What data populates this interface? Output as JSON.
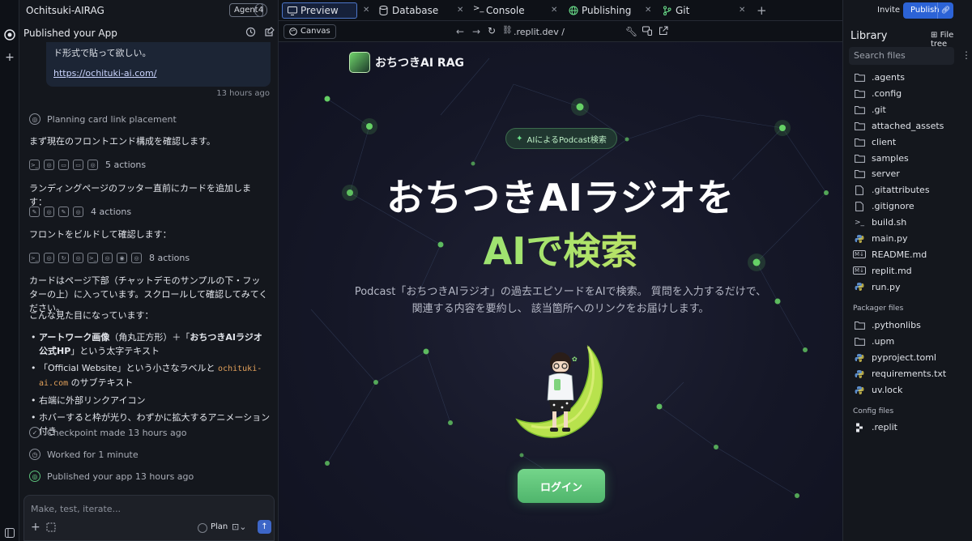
{
  "colors": {
    "accent": "#2c63d6",
    "green": "#6de48e",
    "bg": "#0e1117"
  },
  "chat": {
    "project_name": "Ochitsuki-AIRAG",
    "agent_label": "Agent",
    "agent_count": "4",
    "panel_title": "Published your App",
    "bubble_text": "ド形式で貼って欲しい。",
    "bubble_link": "https://ochituki-ai.com/",
    "bubble_time": "13 hours ago",
    "planning": "Planning card link placement",
    "msg1": "まず現在のフロントエンド構成を確認します。",
    "actions1": "5 actions",
    "msg2": "ランディングページのフッター直前にカードを追加します：",
    "actions2": "4 actions",
    "msg3": "フロントをビルドして確認します：",
    "actions3": "8 actions",
    "msg4": "カードはページ下部（チャットデモのサンプルの下・フッターの上）に入っています。スクロールして確認してみてください。",
    "msg5": "こんな見た目になっています：",
    "bullet1_bold": "アートワーク画像",
    "bullet1_mid": "（角丸正方形）＋「",
    "bullet1_bold2": "おちつきAIラジオ 公式HP",
    "bullet1_end": "」という太字テキスト",
    "bullet2_a": "「Official Website」という小さなラベルと",
    "bullet2_code": "ochituki-ai.com",
    "bullet2_b": "のサブテキスト",
    "bullet3": "右端に外部リンクアイコン",
    "bullet4": "ホバーすると枠が光り、わずかに拡大するアニメーション付き",
    "checkpoint": "Checkpoint made 13 hours ago",
    "worked": "Worked for 1 minute",
    "published": "Published your app 13 hours ago",
    "composer_placeholder": "Make, test, iterate...",
    "plan_label": "Plan"
  },
  "tabs": {
    "items": [
      {
        "label": "Preview",
        "icon": "monitor-icon"
      },
      {
        "label": "Database",
        "icon": "database-icon"
      },
      {
        "label": "Console",
        "icon": "terminal-icon"
      },
      {
        "label": "Publishing",
        "icon": "globe-icon"
      },
      {
        "label": "Git",
        "icon": "git-branch-icon"
      }
    ]
  },
  "urlbar": {
    "canvas_label": "Canvas",
    "url": ".replit.dev /"
  },
  "preview": {
    "brand": "おちつきAI RAG",
    "pill": "AIによるPodcast検索",
    "hero_line1": "おちつきAIラジオを",
    "hero_line2": "AIで検索",
    "description": "Podcast「おちつきAIラジオ」の過去エピソードをAIで検索。 質問を入力するだけで、関連する内容を要約し、 該当箇所へのリンクをお届けします。",
    "login": "ログイン"
  },
  "library": {
    "invite": "Invite",
    "publish": "Publish",
    "title": "Library",
    "file_tree": "File tree",
    "search_placeholder": "Search files",
    "files": [
      {
        "name": ".agents",
        "icon": "folder-icon"
      },
      {
        "name": ".config",
        "icon": "folder-icon"
      },
      {
        "name": ".git",
        "icon": "folder-icon"
      },
      {
        "name": "attached_assets",
        "icon": "folder-icon"
      },
      {
        "name": "client",
        "icon": "folder-icon"
      },
      {
        "name": "samples",
        "icon": "folder-icon"
      },
      {
        "name": "server",
        "icon": "folder-icon"
      },
      {
        "name": ".gitattributes",
        "icon": "file-icon"
      },
      {
        "name": ".gitignore",
        "icon": "file-icon"
      },
      {
        "name": "build.sh",
        "icon": "terminal-file-icon"
      },
      {
        "name": "main.py",
        "icon": "python-icon"
      },
      {
        "name": "README.md",
        "icon": "markdown-icon"
      },
      {
        "name": "replit.md",
        "icon": "markdown-icon"
      },
      {
        "name": "run.py",
        "icon": "python-icon"
      }
    ],
    "packager_title": "Packager files",
    "packager_files": [
      {
        "name": ".pythonlibs",
        "icon": "folder-icon"
      },
      {
        "name": ".upm",
        "icon": "folder-icon"
      },
      {
        "name": "pyproject.toml",
        "icon": "python-icon"
      },
      {
        "name": "requirements.txt",
        "icon": "python-icon"
      },
      {
        "name": "uv.lock",
        "icon": "python-icon"
      }
    ],
    "config_title": "Config files",
    "config_files": [
      {
        "name": ".replit",
        "icon": "replit-icon"
      }
    ]
  }
}
